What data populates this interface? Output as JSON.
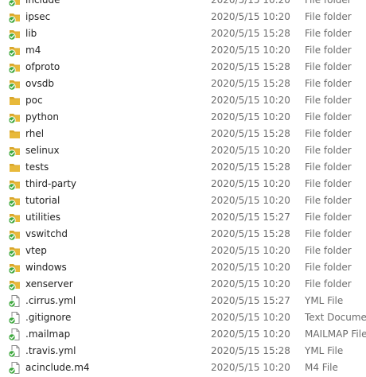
{
  "explorer": {
    "rows": [
      {
        "name": "include",
        "date": "2020/5/15 10:20",
        "type": "File folder",
        "kind": "folder",
        "synced": true
      },
      {
        "name": "ipsec",
        "date": "2020/5/15 10:20",
        "type": "File folder",
        "kind": "folder",
        "synced": true
      },
      {
        "name": "lib",
        "date": "2020/5/15 15:28",
        "type": "File folder",
        "kind": "folder",
        "synced": true
      },
      {
        "name": "m4",
        "date": "2020/5/15 10:20",
        "type": "File folder",
        "kind": "folder",
        "synced": true
      },
      {
        "name": "ofproto",
        "date": "2020/5/15 15:28",
        "type": "File folder",
        "kind": "folder",
        "synced": true
      },
      {
        "name": "ovsdb",
        "date": "2020/5/15 15:28",
        "type": "File folder",
        "kind": "folder",
        "synced": true
      },
      {
        "name": "poc",
        "date": "2020/5/15 10:20",
        "type": "File folder",
        "kind": "folder",
        "synced": false
      },
      {
        "name": "python",
        "date": "2020/5/15 10:20",
        "type": "File folder",
        "kind": "folder",
        "synced": true
      },
      {
        "name": "rhel",
        "date": "2020/5/15 15:28",
        "type": "File folder",
        "kind": "folder",
        "synced": false
      },
      {
        "name": "selinux",
        "date": "2020/5/15 10:20",
        "type": "File folder",
        "kind": "folder",
        "synced": true
      },
      {
        "name": "tests",
        "date": "2020/5/15 15:28",
        "type": "File folder",
        "kind": "folder",
        "synced": false
      },
      {
        "name": "third-party",
        "date": "2020/5/15 10:20",
        "type": "File folder",
        "kind": "folder",
        "synced": true
      },
      {
        "name": "tutorial",
        "date": "2020/5/15 10:20",
        "type": "File folder",
        "kind": "folder",
        "synced": true
      },
      {
        "name": "utilities",
        "date": "2020/5/15 15:27",
        "type": "File folder",
        "kind": "folder",
        "synced": true
      },
      {
        "name": "vswitchd",
        "date": "2020/5/15 15:28",
        "type": "File folder",
        "kind": "folder",
        "synced": true
      },
      {
        "name": "vtep",
        "date": "2020/5/15 10:20",
        "type": "File folder",
        "kind": "folder",
        "synced": true
      },
      {
        "name": "windows",
        "date": "2020/5/15 10:20",
        "type": "File folder",
        "kind": "folder",
        "synced": true
      },
      {
        "name": "xenserver",
        "date": "2020/5/15 10:20",
        "type": "File folder",
        "kind": "folder",
        "synced": true
      },
      {
        "name": ".cirrus.yml",
        "date": "2020/5/15 15:27",
        "type": "YML File",
        "kind": "file",
        "synced": true
      },
      {
        "name": ".gitignore",
        "date": "2020/5/15 10:20",
        "type": "Text Document",
        "kind": "file",
        "synced": true
      },
      {
        "name": ".mailmap",
        "date": "2020/5/15 10:20",
        "type": "MAILMAP File",
        "kind": "file",
        "synced": true
      },
      {
        "name": ".travis.yml",
        "date": "2020/5/15 15:28",
        "type": "YML File",
        "kind": "file",
        "synced": true
      },
      {
        "name": "acinclude.m4",
        "date": "2020/5/15 10:20",
        "type": "M4 File",
        "kind": "file",
        "synced": true
      }
    ]
  },
  "colors": {
    "folder": "#e8b93a",
    "folder_tab": "#d9a62a",
    "sync_badge": "#3da83d",
    "file_page": "#ffffff",
    "file_border": "#8a8a8a",
    "date_text": "#6d6d6d",
    "name_text": "#1f1f1f"
  },
  "icons": {
    "folder": "folder-icon",
    "file": "file-icon",
    "sync": "sync-status-icon"
  }
}
